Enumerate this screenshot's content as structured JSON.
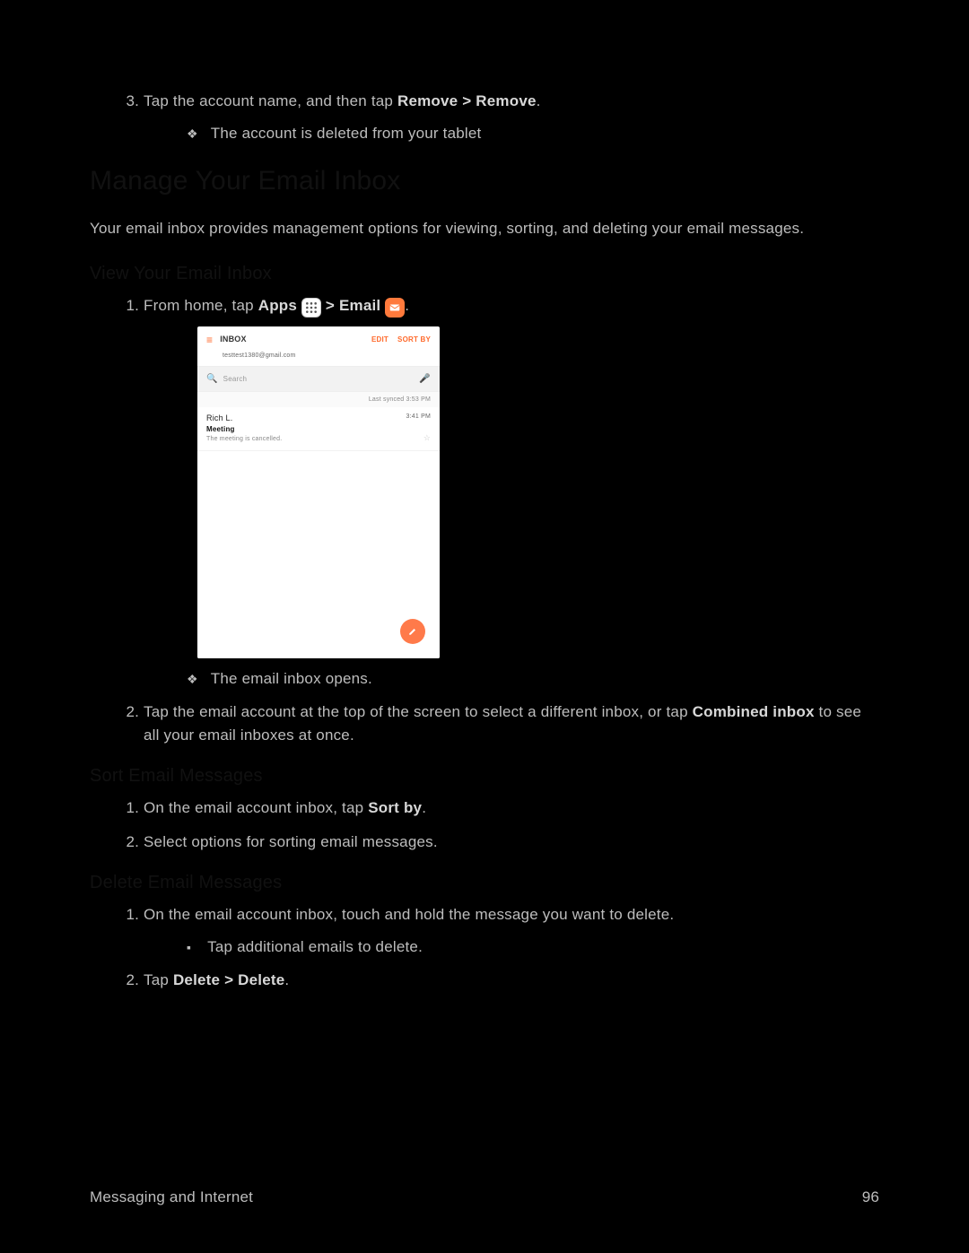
{
  "step3_prefix": "Tap the account name, and then tap ",
  "step3_bold": "Remove > Remove",
  "step3_suffix": ".",
  "step3_result": "The account is deleted from your tablet",
  "heading_manage": "Manage Your Email Inbox",
  "intro_manage": "Your email inbox provides management options for viewing, sorting, and deleting your email messages.",
  "sub_view": "View Your Email Inbox",
  "view_step1_prefix": "From home, tap ",
  "view_step1_apps": "Apps",
  "view_step1_mid": " > ",
  "view_step1_email": "Email",
  "view_step1_suffix": ".",
  "screenshot": {
    "inbox_label": "INBOX",
    "account": "testtest1380@gmail.com",
    "edit": "EDIT",
    "sortby": "SORT BY",
    "search": "Search",
    "last_sync": "Last synced 3:53 PM",
    "row_from": "Rich L.",
    "row_time": "3:41 PM",
    "row_subject": "Meeting",
    "row_preview": "The meeting is cancelled."
  },
  "view_result": "The email inbox opens.",
  "view_step2_prefix": "Tap the email account at the top of the screen to select a different inbox, or tap ",
  "view_step2_bold": "Combined inbox",
  "view_step2_suffix": " to see all your email inboxes at once.",
  "sub_sort": "Sort Email Messages",
  "sort_step1_prefix": "On the email account inbox, tap ",
  "sort_step1_bold": "Sort by",
  "sort_step1_suffix": ".",
  "sort_step2": "Select options for sorting email messages.",
  "sub_delete": "Delete Email Messages",
  "del_step1": "On the email account inbox, touch and hold the message you want to delete.",
  "del_step1_sub": "Tap additional emails to delete.",
  "del_step2_prefix": "Tap ",
  "del_step2_bold": "Delete > Delete",
  "del_step2_suffix": ".",
  "footer_left": "Messaging and Internet",
  "footer_right": "96"
}
